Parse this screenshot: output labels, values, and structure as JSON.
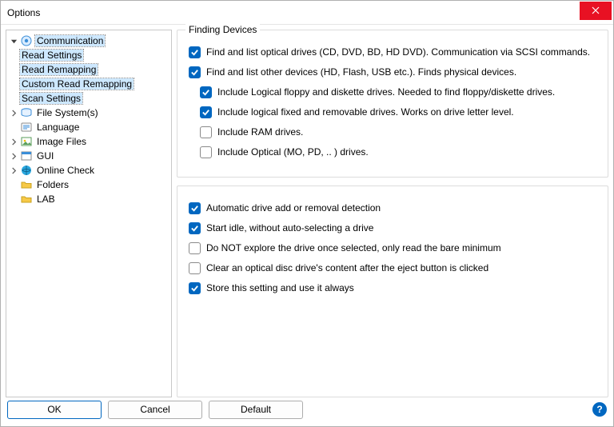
{
  "window": {
    "title": "Options"
  },
  "tree": {
    "communication": "Communication",
    "read_settings": "Read Settings",
    "read_remapping": "Read Remapping",
    "custom_read_remapping": "Custom Read Remapping",
    "scan_settings": "Scan Settings",
    "file_systems": "File System(s)",
    "language": "Language",
    "image_files": "Image Files",
    "gui": "GUI",
    "online_check": "Online Check",
    "folders": "Folders",
    "lab": "LAB"
  },
  "group": {
    "finding_devices": "Finding Devices"
  },
  "options": {
    "find_optical": {
      "label": "Find and list optical drives (CD, DVD, BD, HD DVD).  Communication via SCSI commands.",
      "checked": true
    },
    "find_other": {
      "label": "Find and list other devices (HD, Flash, USB etc.).  Finds physical devices.",
      "checked": true
    },
    "include_floppy": {
      "label": "Include Logical floppy and diskette drives.  Needed to find floppy/diskette drives.",
      "checked": true
    },
    "include_fixed": {
      "label": "Include logical fixed and removable drives.  Works on drive letter level.",
      "checked": true
    },
    "include_ram": {
      "label": "Include RAM drives.",
      "checked": false
    },
    "include_optical": {
      "label": "Include Optical (MO, PD, .. ) drives.",
      "checked": false
    },
    "auto_detect": {
      "label": "Automatic drive add or removal detection",
      "checked": true
    },
    "start_idle": {
      "label": "Start idle, without auto-selecting a drive",
      "checked": true
    },
    "no_explore": {
      "label": "Do NOT explore the drive once selected, only read the bare minimum",
      "checked": false
    },
    "clear_content": {
      "label": "Clear an optical disc drive's content after the eject button is clicked",
      "checked": false
    },
    "store_setting": {
      "label": "Store this setting and use it always",
      "checked": true
    }
  },
  "buttons": {
    "ok": "OK",
    "cancel": "Cancel",
    "default": "Default"
  }
}
